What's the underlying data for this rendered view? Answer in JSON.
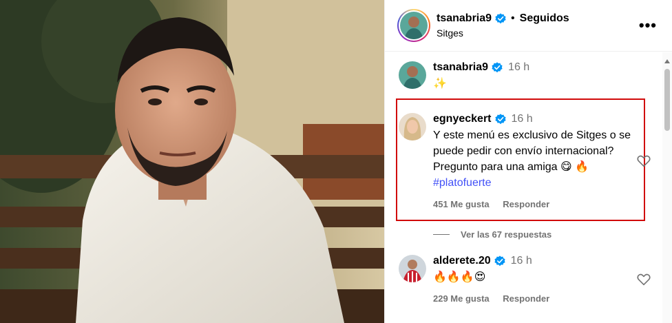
{
  "post": {
    "username": "tsanabria9",
    "follow_status": "Seguidos",
    "separator": "•",
    "location": "Sitges",
    "more_label": "•••"
  },
  "comments": [
    {
      "username": "tsanabria9",
      "time": "16 h",
      "text": "✨"
    },
    {
      "username": "egnyeckert",
      "time": "16 h",
      "text": "Y este menú es exclusivo de Sitges o se puede pedir con envío internacional? Pregunto para una amiga 😋 🔥",
      "hashtag": "#platofuerte",
      "likes": "451 Me gusta",
      "reply": "Responder",
      "view_replies": "Ver las 67 respuestas"
    },
    {
      "username": "alderete.20",
      "time": "16 h",
      "text": "🔥🔥🔥😍",
      "likes": "229 Me gusta",
      "reply": "Responder"
    }
  ],
  "colors": {
    "highlight": "#d10a0a",
    "verified": "#0095f6",
    "hashtag": "#4150f7",
    "secondary": "#737373"
  }
}
